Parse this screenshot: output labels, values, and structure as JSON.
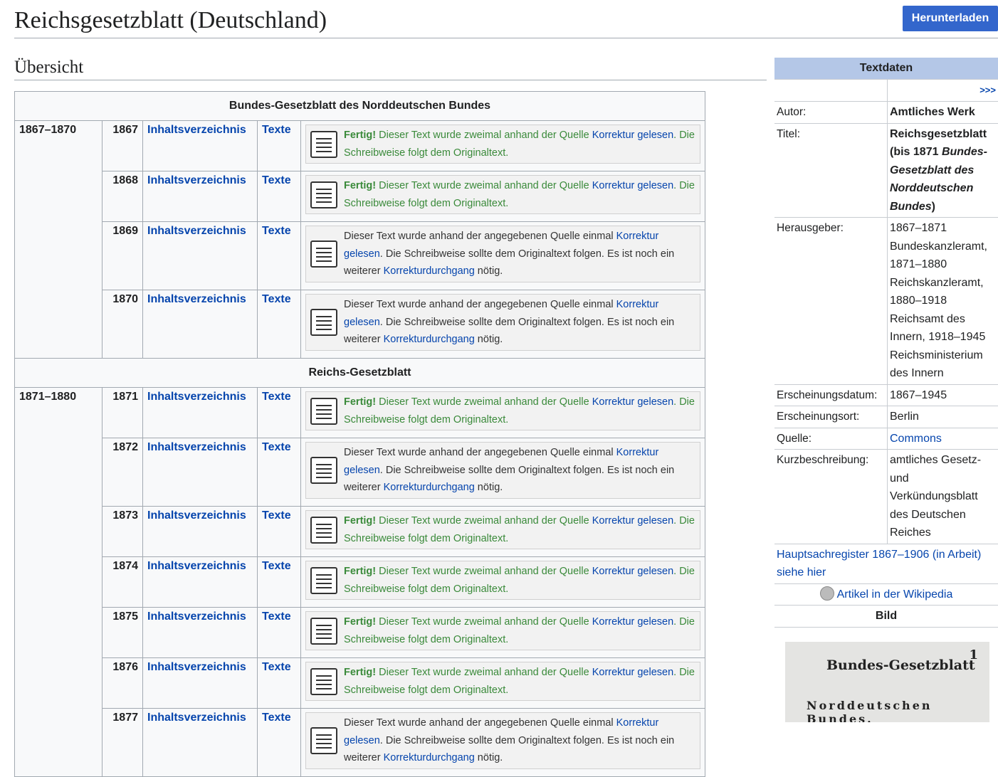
{
  "page": {
    "title": "Reichsgesetzblatt (Deutschland)",
    "download_label": "Herunterladen",
    "section_heading": "Übersicht"
  },
  "groups": [
    {
      "heading": "Bundes-Gesetzblatt des Norddeutschen Bundes",
      "range": "1867–1870",
      "rows": [
        {
          "year": "1867",
          "index": "Inhaltsverzeichnis",
          "texts": "Texte",
          "status": "done"
        },
        {
          "year": "1868",
          "index": "Inhaltsverzeichnis",
          "texts": "Texte",
          "status": "done"
        },
        {
          "year": "1869",
          "index": "Inhaltsverzeichnis",
          "texts": "Texte",
          "status": "once"
        },
        {
          "year": "1870",
          "index": "Inhaltsverzeichnis",
          "texts": "Texte",
          "status": "once"
        }
      ]
    },
    {
      "heading": "Reichs-Gesetzblatt",
      "range": "1871–1880",
      "rows": [
        {
          "year": "1871",
          "index": "Inhaltsverzeichnis",
          "texts": "Texte",
          "status": "done"
        },
        {
          "year": "1872",
          "index": "Inhaltsverzeichnis",
          "texts": "Texte",
          "status": "once"
        },
        {
          "year": "1873",
          "index": "Inhaltsverzeichnis",
          "texts": "Texte",
          "status": "done"
        },
        {
          "year": "1874",
          "index": "Inhaltsverzeichnis",
          "texts": "Texte",
          "status": "done"
        },
        {
          "year": "1875",
          "index": "Inhaltsverzeichnis",
          "texts": "Texte",
          "status": "done"
        },
        {
          "year": "1876",
          "index": "Inhaltsverzeichnis",
          "texts": "Texte",
          "status": "done"
        },
        {
          "year": "1877",
          "index": "Inhaltsverzeichnis",
          "texts": "Texte",
          "status": "once"
        }
      ]
    }
  ],
  "status_text": {
    "done": {
      "strong": "Fertig!",
      "pre": " Dieser Text wurde zweimal anhand der Quelle ",
      "link": "Korrektur gelesen",
      "post": ". Die Schreibweise folgt dem Originaltext."
    },
    "once": {
      "pre": "Dieser Text wurde anhand der angegebenen Quelle einmal ",
      "link": "Korrektur gelesen",
      "mid": ". Die Schreibweise sollte dem Originaltext folgen. Es ist noch ein weiterer ",
      "link2": "Korrekturdurchgang",
      "post": " nötig."
    }
  },
  "infobox": {
    "heading": "Textdaten",
    "more": ">>>",
    "rows": [
      {
        "label": "Autor:",
        "value": "Amtliches Werk"
      },
      {
        "label": "Titel:",
        "value_bold_1": "Reichsgesetzblatt (bis 1871 ",
        "value_italic": "Bundes-Gesetzblatt des Norddeutschen Bundes",
        "value_bold_2": ")"
      },
      {
        "label": "Herausgeber:",
        "value": "1867–1871 Bundeskanzleramt, 1871–1880 Reichskanzleramt, 1880–1918 Reichsamt des Innern, 1918–1945 Reichsministerium des Innern"
      },
      {
        "label": "Erscheinungsdatum:",
        "value": "1867–1945"
      },
      {
        "label": "Erscheinungsort:",
        "value": "Berlin"
      },
      {
        "label": "Quelle:",
        "value": "Commons"
      },
      {
        "label": "Kurzbeschreibung:",
        "value": "amtliches Gesetz- und Verkündungsblatt des Deutschen Reiches"
      }
    ],
    "register_link": "Hauptsachregister 1867–1906 (in Arbeit) siehe hier",
    "wikipedia_link": "Artikel in der Wikipedia",
    "image_heading": "Bild",
    "image_text_1": "Bundes-Gesetzblatt",
    "image_text_2": "Norddeutschen Bundes.",
    "image_page": "1"
  }
}
